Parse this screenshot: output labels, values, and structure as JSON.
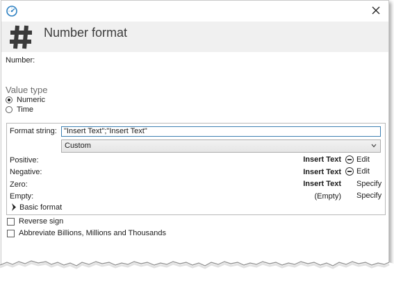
{
  "header": {
    "title": "Number format"
  },
  "number_label": "Number:",
  "value_type": {
    "title": "Value type",
    "options": [
      {
        "label": "Numeric",
        "selected": true
      },
      {
        "label": "Time",
        "selected": false
      }
    ]
  },
  "format": {
    "format_string_label": "Format string:",
    "format_string_value": "\"Insert Text\";\"Insert Text\"",
    "dropdown_value": "Custom",
    "rows": [
      {
        "label": "Positive:",
        "value": "Insert Text",
        "action": "Edit"
      },
      {
        "label": "Negative:",
        "value": "Insert Text",
        "action": "Edit"
      },
      {
        "label": "Zero:",
        "value": "Insert Text",
        "action": "Specify"
      },
      {
        "label": "Empty:",
        "value": "(Empty)",
        "action": "Specify"
      }
    ],
    "basic_format_label": "Basic format"
  },
  "checkboxes": [
    {
      "label": "Reverse sign",
      "checked": false
    },
    {
      "label": "Abbreviate Billions, Millions and Thousands",
      "checked": false
    }
  ],
  "icons": {
    "app": "gauge-icon",
    "header": "hash-icon",
    "close": "close-icon",
    "dropdown": "chevron-down-icon",
    "expander": "chevron-right-icon",
    "edit": "minus-circle-icon"
  },
  "colors": {
    "header_bg": "#f0f0f0",
    "input_border": "#3c7fb1",
    "app_icon": "#2a7fc1"
  }
}
